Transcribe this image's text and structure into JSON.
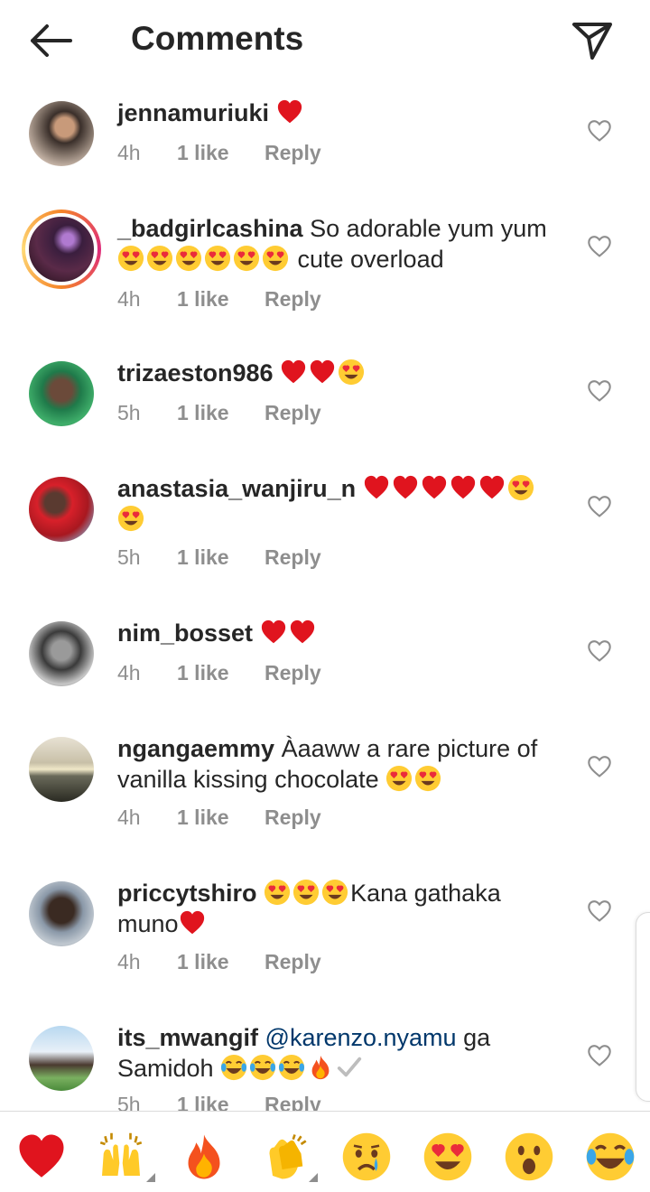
{
  "header": {
    "title": "Comments",
    "back_icon": "arrow-left-icon",
    "share_icon": "paper-plane-icon"
  },
  "colors": {
    "heart_red": "#ed4956",
    "text": "#262626",
    "muted": "#8e8e8e",
    "mention": "#00376b"
  },
  "reply_label": "Reply",
  "comments": [
    {
      "username": "jennamuriuki",
      "text": "",
      "emojis_after": [
        "heart"
      ],
      "time": "4h",
      "likes": "1 like"
    },
    {
      "username": "_badgirlcashina",
      "text": " So adorable yum yum",
      "line2_emojis": [
        "heart-eyes",
        "heart-eyes",
        "heart-eyes",
        "heart-eyes",
        "heart-eyes",
        "heart-eyes"
      ],
      "line2_text": " cute overload",
      "time": "4h",
      "likes": "1 like"
    },
    {
      "username": "trizaeston986",
      "text": "",
      "emojis_after": [
        "heart",
        "heart",
        "heart-eyes"
      ],
      "time": "5h",
      "likes": "1 like"
    },
    {
      "username": "anastasia_wanjiru_n",
      "text": "",
      "emojis_after": [
        "heart",
        "heart",
        "heart",
        "heart",
        "heart",
        "heart-eyes",
        "heart-eyes"
      ],
      "time": "5h",
      "likes": "1 like"
    },
    {
      "username": "nim_bosset",
      "text": "",
      "emojis_after": [
        "heart",
        "heart"
      ],
      "time": "4h",
      "likes": "1 like"
    },
    {
      "username": "ngangaemmy",
      "text": " Àaaww a rare picture of",
      "line2_text": "vanilla kissing chocolate ",
      "emojis_after": [
        "heart-eyes",
        "heart-eyes"
      ],
      "time": "4h",
      "likes": "1 like"
    },
    {
      "username": "priccytshiro",
      "text": "Kana gathaka",
      "line2_text": "muno",
      "emojis_after": [
        "heart-eyes",
        "heart-eyes",
        "heart-eyes",
        "heart"
      ],
      "time": "4h",
      "likes": "1 like"
    },
    {
      "username": "its_mwangif",
      "mention": "@karenzo.nyamu",
      "text": "  ga",
      "line2_text": "Samidoh ",
      "emojis_after": [
        "joy",
        "joy",
        "joy",
        "fire",
        "check"
      ],
      "time": "5h",
      "likes": "1 like"
    }
  ],
  "reactions": [
    "heart",
    "raised-hands",
    "fire",
    "clapping-hands",
    "crying-face",
    "heart-eyes",
    "surprised-face",
    "joy"
  ]
}
